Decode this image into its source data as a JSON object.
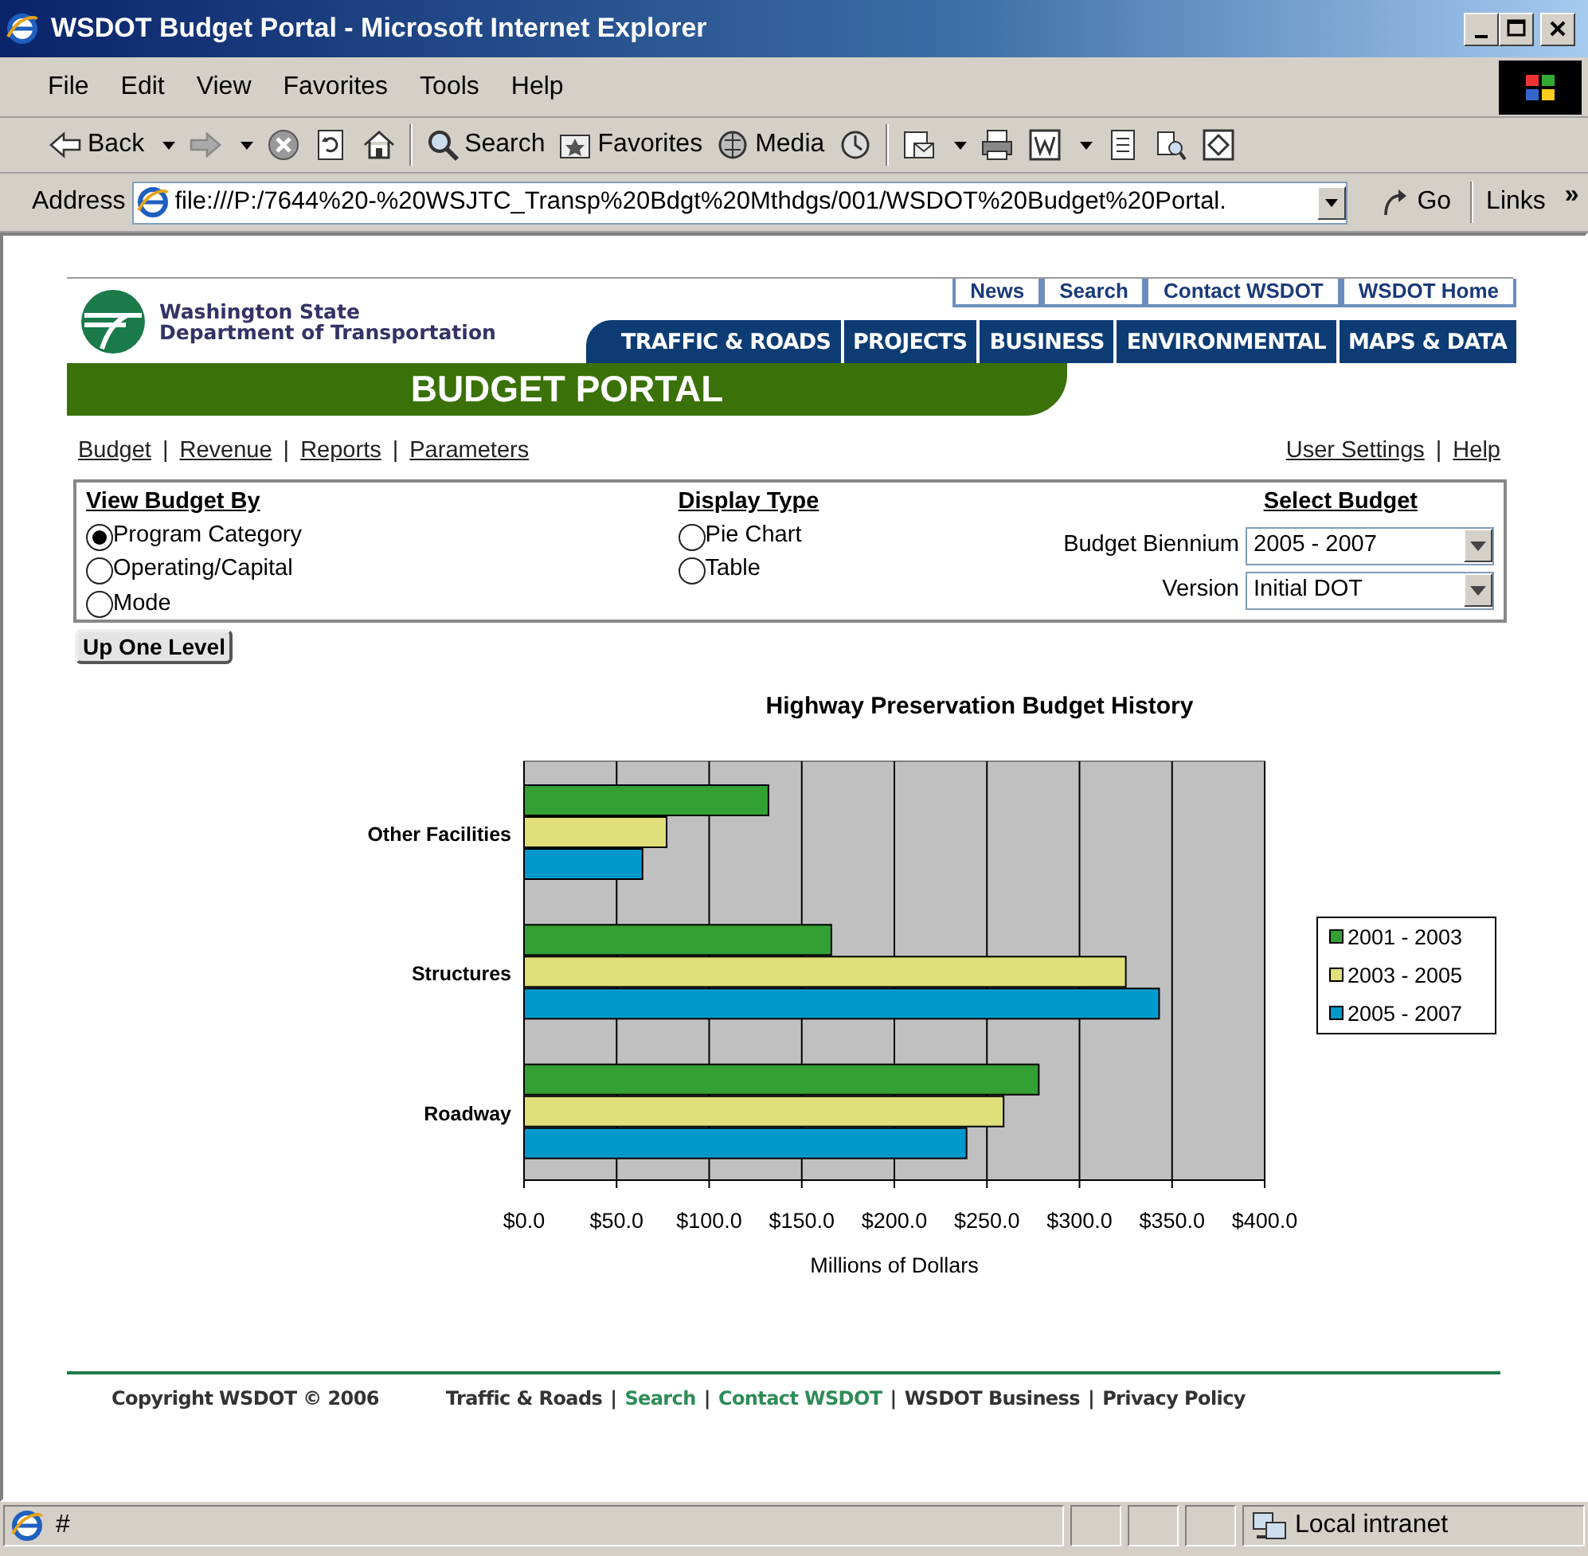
{
  "window": {
    "title": "WSDOT Budget Portal - Microsoft Internet Explorer"
  },
  "menu": [
    "File",
    "Edit",
    "View",
    "Favorites",
    "Tools",
    "Help"
  ],
  "toolbar": {
    "back": "Back",
    "search": "Search",
    "favorites": "Favorites",
    "media": "Media"
  },
  "address_bar": {
    "label": "Address",
    "value": "file:///P:/7644%20-%20WSJTC_Transp%20Bdgt%20Mthdgs/001/WSDOT%20Budget%20Portal.",
    "go": "Go",
    "links": "Links",
    "links_chevron": "»"
  },
  "header": {
    "agency": [
      "Washington State",
      "Department of Transportation"
    ],
    "top_links": [
      "News",
      "Search",
      "Contact WSDOT",
      "WSDOT Home"
    ],
    "nav_tabs": [
      "TRAFFIC & ROADS",
      "PROJECTS",
      "BUSINESS",
      "ENVIRONMENTAL",
      "MAPS & DATA"
    ],
    "banner": "BUDGET PORTAL"
  },
  "separator": "|",
  "sub_links_left": [
    "Budget",
    "Revenue",
    "Reports",
    "Parameters"
  ],
  "sub_links_right": [
    "User Settings",
    "Help"
  ],
  "view_budget_by": {
    "heading": "View Budget By",
    "options": [
      {
        "label": "Program Category",
        "selected": true
      },
      {
        "label": "Operating/Capital",
        "selected": false
      },
      {
        "label": "Mode",
        "selected": false
      }
    ]
  },
  "display_type": {
    "heading": "Display Type",
    "options": [
      {
        "label": "Pie Chart",
        "selected": false
      },
      {
        "label": "Table",
        "selected": false
      }
    ]
  },
  "select_budget": {
    "heading": "Select Budget",
    "fields": [
      {
        "label": "Budget Biennium",
        "value": "2005 - 2007"
      },
      {
        "label": "Version",
        "value": "Initial DOT"
      }
    ]
  },
  "up_button": "Up One Level",
  "chart_data": {
    "type": "bar",
    "orientation": "horizontal",
    "title": "Highway Preservation Budget History",
    "xlabel": "Millions of Dollars",
    "categories": [
      "Other Facilities",
      "Structures",
      "Roadway"
    ],
    "series": [
      {
        "name": "2001 - 2003",
        "color": "#33a033",
        "values": [
          132,
          166,
          278
        ]
      },
      {
        "name": "2003 - 2005",
        "color": "#e0e07a",
        "values": [
          77,
          325,
          259
        ]
      },
      {
        "name": "2005 - 2007",
        "color": "#0099cc",
        "values": [
          64,
          343,
          239
        ]
      }
    ],
    "grid": true,
    "legend": true,
    "xlim": [
      0,
      400
    ],
    "xticks": [
      {
        "value": 0,
        "label": "$0.0"
      },
      {
        "value": 50,
        "label": "$50.0"
      },
      {
        "value": 100,
        "label": "$100.0"
      },
      {
        "value": 150,
        "label": "$150.0"
      },
      {
        "value": 200,
        "label": "$200.0"
      },
      {
        "value": 250,
        "label": "$250.0"
      },
      {
        "value": 300,
        "label": "$300.0"
      },
      {
        "value": 350,
        "label": "$350.0"
      },
      {
        "value": 400,
        "label": "$400.0"
      }
    ]
  },
  "footer": {
    "copyright": "Copyright WSDOT © 2006",
    "links": [
      {
        "label": "Traffic & Roads",
        "kind": "plain"
      },
      {
        "label": "Search",
        "kind": "green"
      },
      {
        "label": "Contact WSDOT",
        "kind": "green"
      },
      {
        "label": "WSDOT Business",
        "kind": "plain"
      },
      {
        "label": "Privacy Policy",
        "kind": "plain"
      }
    ]
  },
  "status_bar": {
    "text": "#",
    "zone": "Local intranet"
  }
}
